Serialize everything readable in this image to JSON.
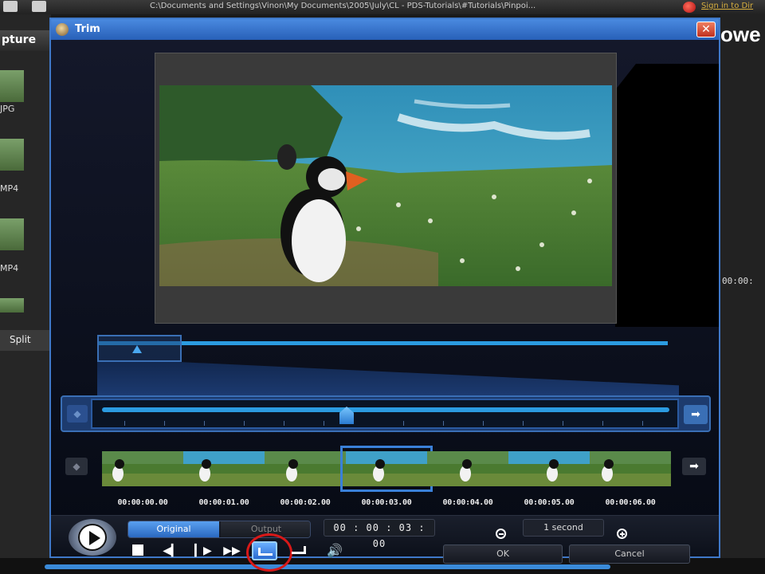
{
  "app": {
    "title_path": "C:\\Documents and Settings\\Vinon\\My Documents\\2005\\July\\CL - PDS-Tutorials\\#Tutorials\\Pinpoi...",
    "signin": "Sign in to Dir",
    "capture_tab": "pture",
    "brand_partial": "owe",
    "media_labels": [
      "JPG",
      "MP4",
      "MP4"
    ],
    "split_label": "Split",
    "right_time": "00:00:"
  },
  "dialog": {
    "title": "Trim",
    "close_glyph": "✕"
  },
  "preview": {
    "icon_name": "puffin-video-frame"
  },
  "timeline": {
    "frame_times": [
      "00:00:00.00",
      "00:00:01.00",
      "00:00:02.00",
      "00:00:03.00",
      "00:00:04.00",
      "00:00:05.00",
      "00:00:06.00"
    ],
    "selected_index": 3,
    "left_arrow": "◆",
    "right_arrow": "➡"
  },
  "controls": {
    "mode_original": "Original",
    "mode_output": "Output",
    "timecode": "00 : 00 : 03 : 00",
    "zoom_label": "1 second",
    "ok_label": "OK",
    "cancel_label": "Cancel"
  }
}
